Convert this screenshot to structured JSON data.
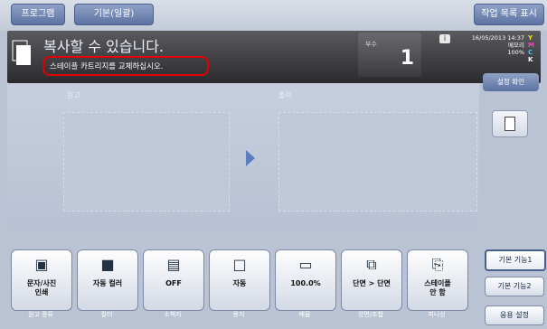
{
  "tabs": {
    "program": "프로그램",
    "basic": "기본(일괄)",
    "job_list": "작업 목록 표시"
  },
  "status": {
    "main": "복사할 수 있습니다.",
    "sub": "스테이플 카트리지를 교체하십시오.",
    "count_label": "부수",
    "count_value": "1",
    "datetime": "16/05/2013 14:37",
    "memory": "메모리",
    "memory_percent": "100%",
    "toner": [
      "Y",
      "M",
      "C",
      "K"
    ]
  },
  "main": {
    "original_label": "원고",
    "output_label": "출력",
    "confirm_label": "설정 확인"
  },
  "bottom_buttons": [
    {
      "label": "문자/사진\n인쇄",
      "caption": "원고 종류"
    },
    {
      "label": "자동 컬러",
      "caption": "컬러"
    },
    {
      "label": "OFF",
      "caption": "소책자"
    },
    {
      "label": "자동",
      "caption": "용지"
    },
    {
      "label": "100.0%",
      "caption": "배율"
    },
    {
      "label": "단면 > 단면",
      "caption": "양면/조합"
    },
    {
      "label": "스테이플\n안 함",
      "caption": "피니싱"
    }
  ],
  "side": {
    "basic1": "기본 기능1",
    "basic2": "기본 기능2",
    "apply": "응용 설정"
  },
  "colors": {
    "accent": "#5c72a2",
    "red": "#e00000"
  }
}
